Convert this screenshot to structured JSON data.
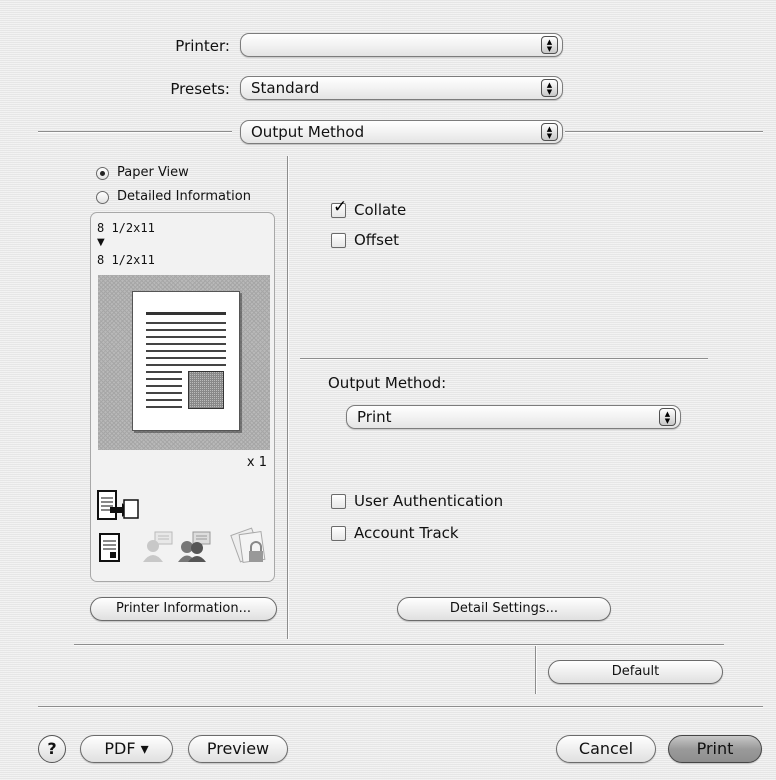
{
  "header": {
    "printer_label": "Printer:",
    "printer_value": "",
    "presets_label": "Presets:",
    "presets_value": "Standard",
    "panel_value": "Output Method"
  },
  "preview_panel": {
    "view_options": [
      "Paper View",
      "Detailed Information"
    ],
    "selected_view": "Paper View",
    "paper_from": "8 1/2x11",
    "arrow": "▼",
    "paper_to": "8 1/2x11",
    "copies": "x 1",
    "printer_information_button": "Printer Information..."
  },
  "options": {
    "collate_label": "Collate",
    "collate_checked": true,
    "offset_label": "Offset",
    "offset_checked": false,
    "output_method_label": "Output Method:",
    "output_method_value": "Print",
    "user_auth_label": "User Authentication",
    "user_auth_checked": false,
    "account_track_label": "Account Track",
    "account_track_checked": false,
    "detail_settings_button": "Detail Settings..."
  },
  "default_button": "Default",
  "footer": {
    "help": "?",
    "pdf_button": "PDF ▾",
    "preview_button": "Preview",
    "cancel_button": "Cancel",
    "print_button": "Print"
  },
  "icons": [
    "up-down-arrows-icon",
    "output-tray-icon",
    "document-icon",
    "user-icon",
    "group-icon",
    "lock-icon",
    "help-icon"
  ]
}
